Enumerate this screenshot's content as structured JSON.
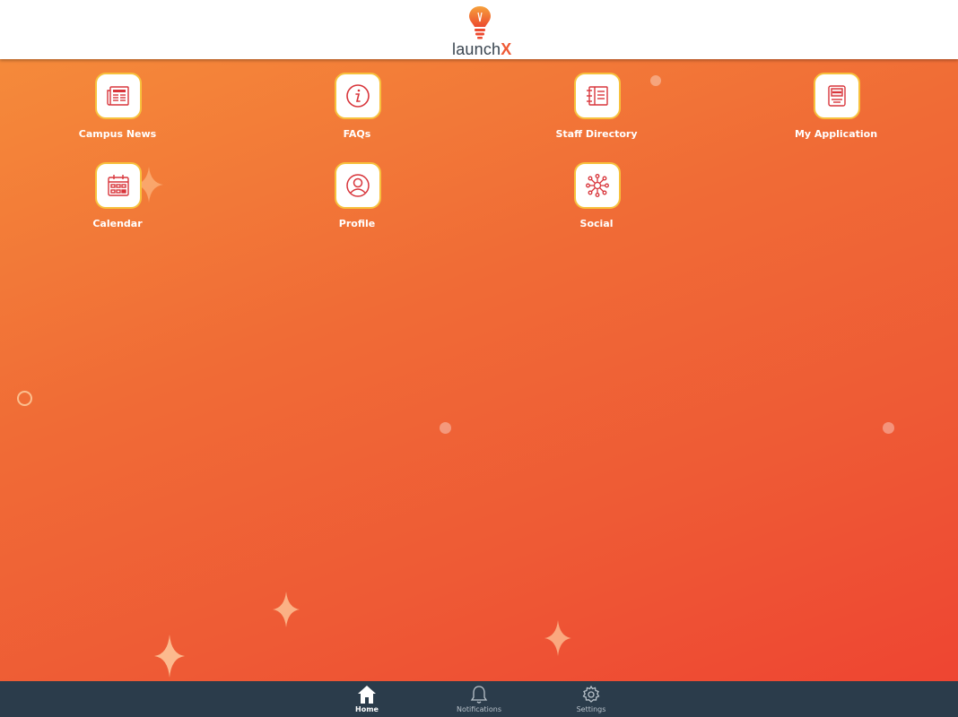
{
  "header": {
    "logo_word": "launch",
    "logo_x": "X"
  },
  "colors": {
    "accent": "#ef5a35",
    "tile_border": "#f7c13d",
    "icon_red": "#d8353b",
    "nav_bg": "#2b3c4b"
  },
  "tiles": [
    {
      "label": "Campus News",
      "icon": "newspaper-icon"
    },
    {
      "label": "FAQs",
      "icon": "info-icon"
    },
    {
      "label": "Staff Directory",
      "icon": "directory-icon"
    },
    {
      "label": "My Application",
      "icon": "application-icon"
    },
    {
      "label": "Calendar",
      "icon": "calendar-icon"
    },
    {
      "label": "Profile",
      "icon": "profile-icon"
    },
    {
      "label": "Social",
      "icon": "social-network-icon"
    }
  ],
  "bottom_nav": [
    {
      "label": "Home",
      "icon": "home-icon",
      "active": true
    },
    {
      "label": "Notifications",
      "icon": "bell-icon",
      "active": false
    },
    {
      "label": "Settings",
      "icon": "gear-icon",
      "active": false
    }
  ]
}
